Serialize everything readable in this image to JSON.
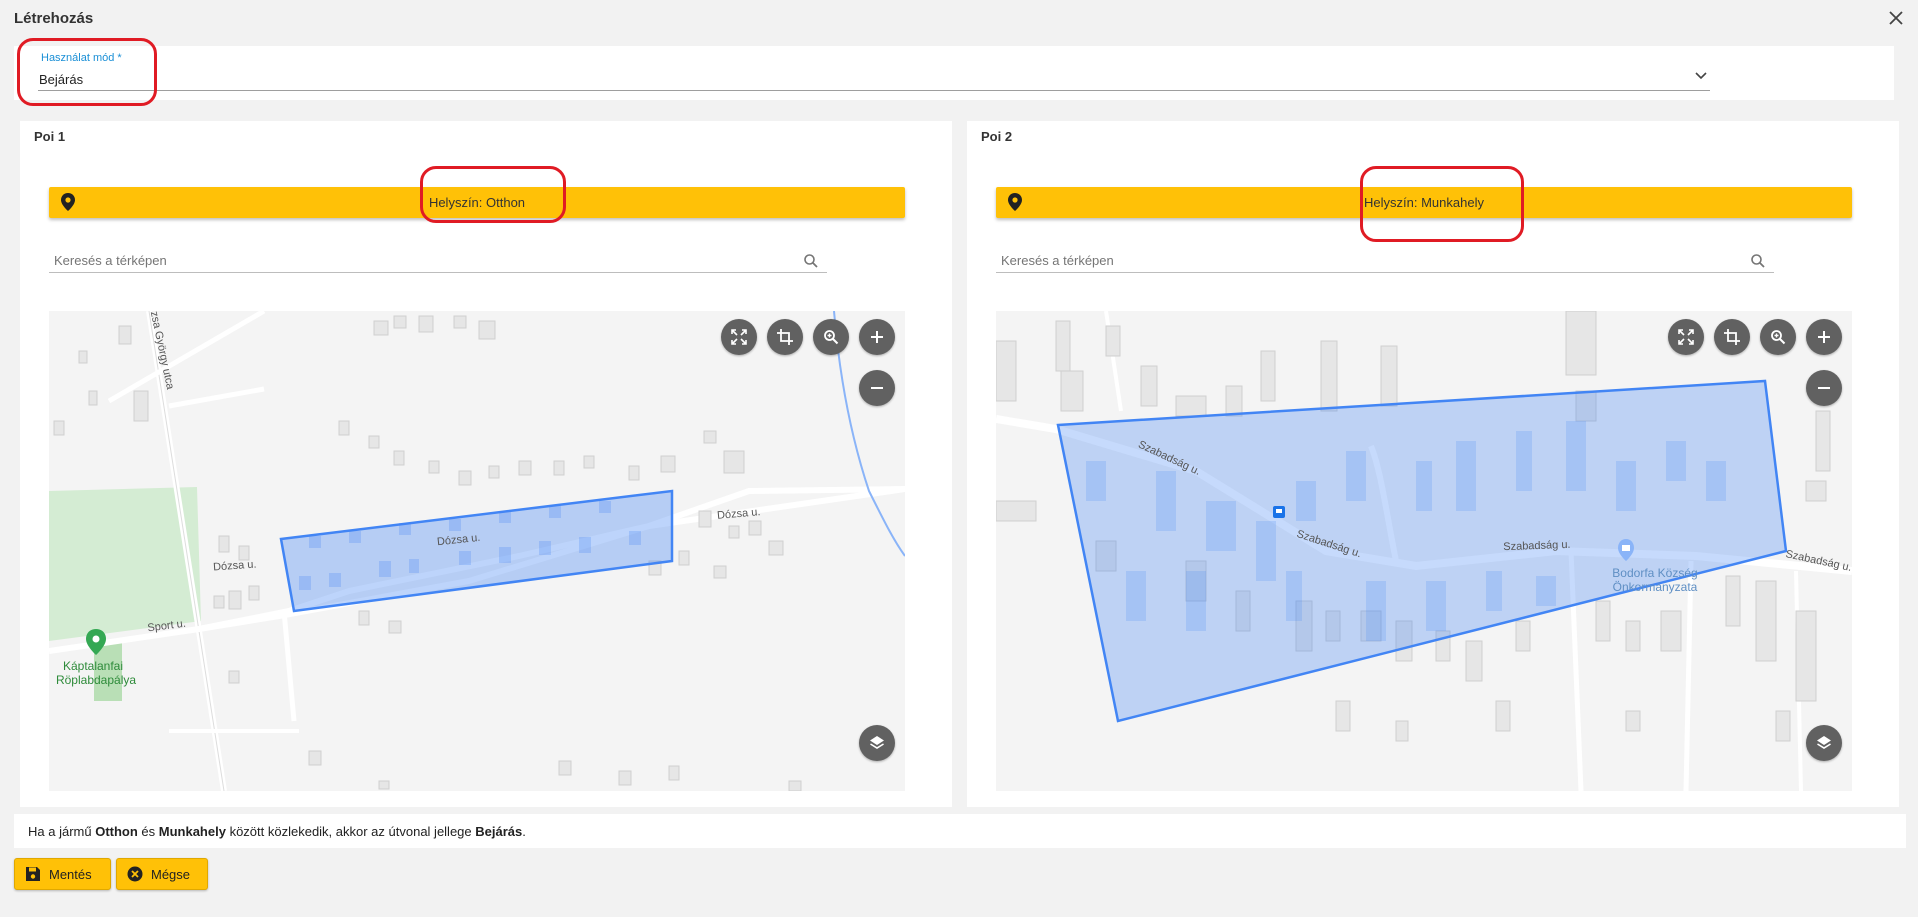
{
  "dialog": {
    "title": "Létrehozás"
  },
  "mode": {
    "label": "Használat mód *",
    "value": "Bejárás"
  },
  "poi1": {
    "title": "Poi 1",
    "location": "Helyszín: Otthon",
    "search_placeholder": "Keresés a térképen",
    "map_labels": {
      "street_1": "Dózsa u.",
      "street_2": "Dózsa u.",
      "street_3": "Dózsa u.",
      "street_4": "Sport u.",
      "street_5": "zsa György utca",
      "poi_name_1": "Káptalanfai",
      "poi_name_2": "Röplabdapálya"
    }
  },
  "poi2": {
    "title": "Poi 2",
    "location": "Helyszín: Munkahely",
    "search_placeholder": "Keresés a térképen",
    "map_labels": {
      "street_1": "Szabadság u.",
      "street_2": "Szabadság u.",
      "street_3": "Szabadság u.",
      "street_4": "Szabadság u.",
      "poi_name_1": "Bodorfa Község",
      "poi_name_2": "Önkormányzata"
    }
  },
  "info": {
    "part1": "Ha a jármű ",
    "home": "Otthon",
    "part2": " és ",
    "work": "Munkahely",
    "part3": " között közlekedik, akkor az útvonal jellege ",
    "mode": "Bejárás",
    "part4": "."
  },
  "actions": {
    "save": "Mentés",
    "cancel": "Mégse"
  },
  "colors": {
    "accent": "#ffc107",
    "polygon": "#4285f4",
    "annotation": "#e01b24"
  }
}
